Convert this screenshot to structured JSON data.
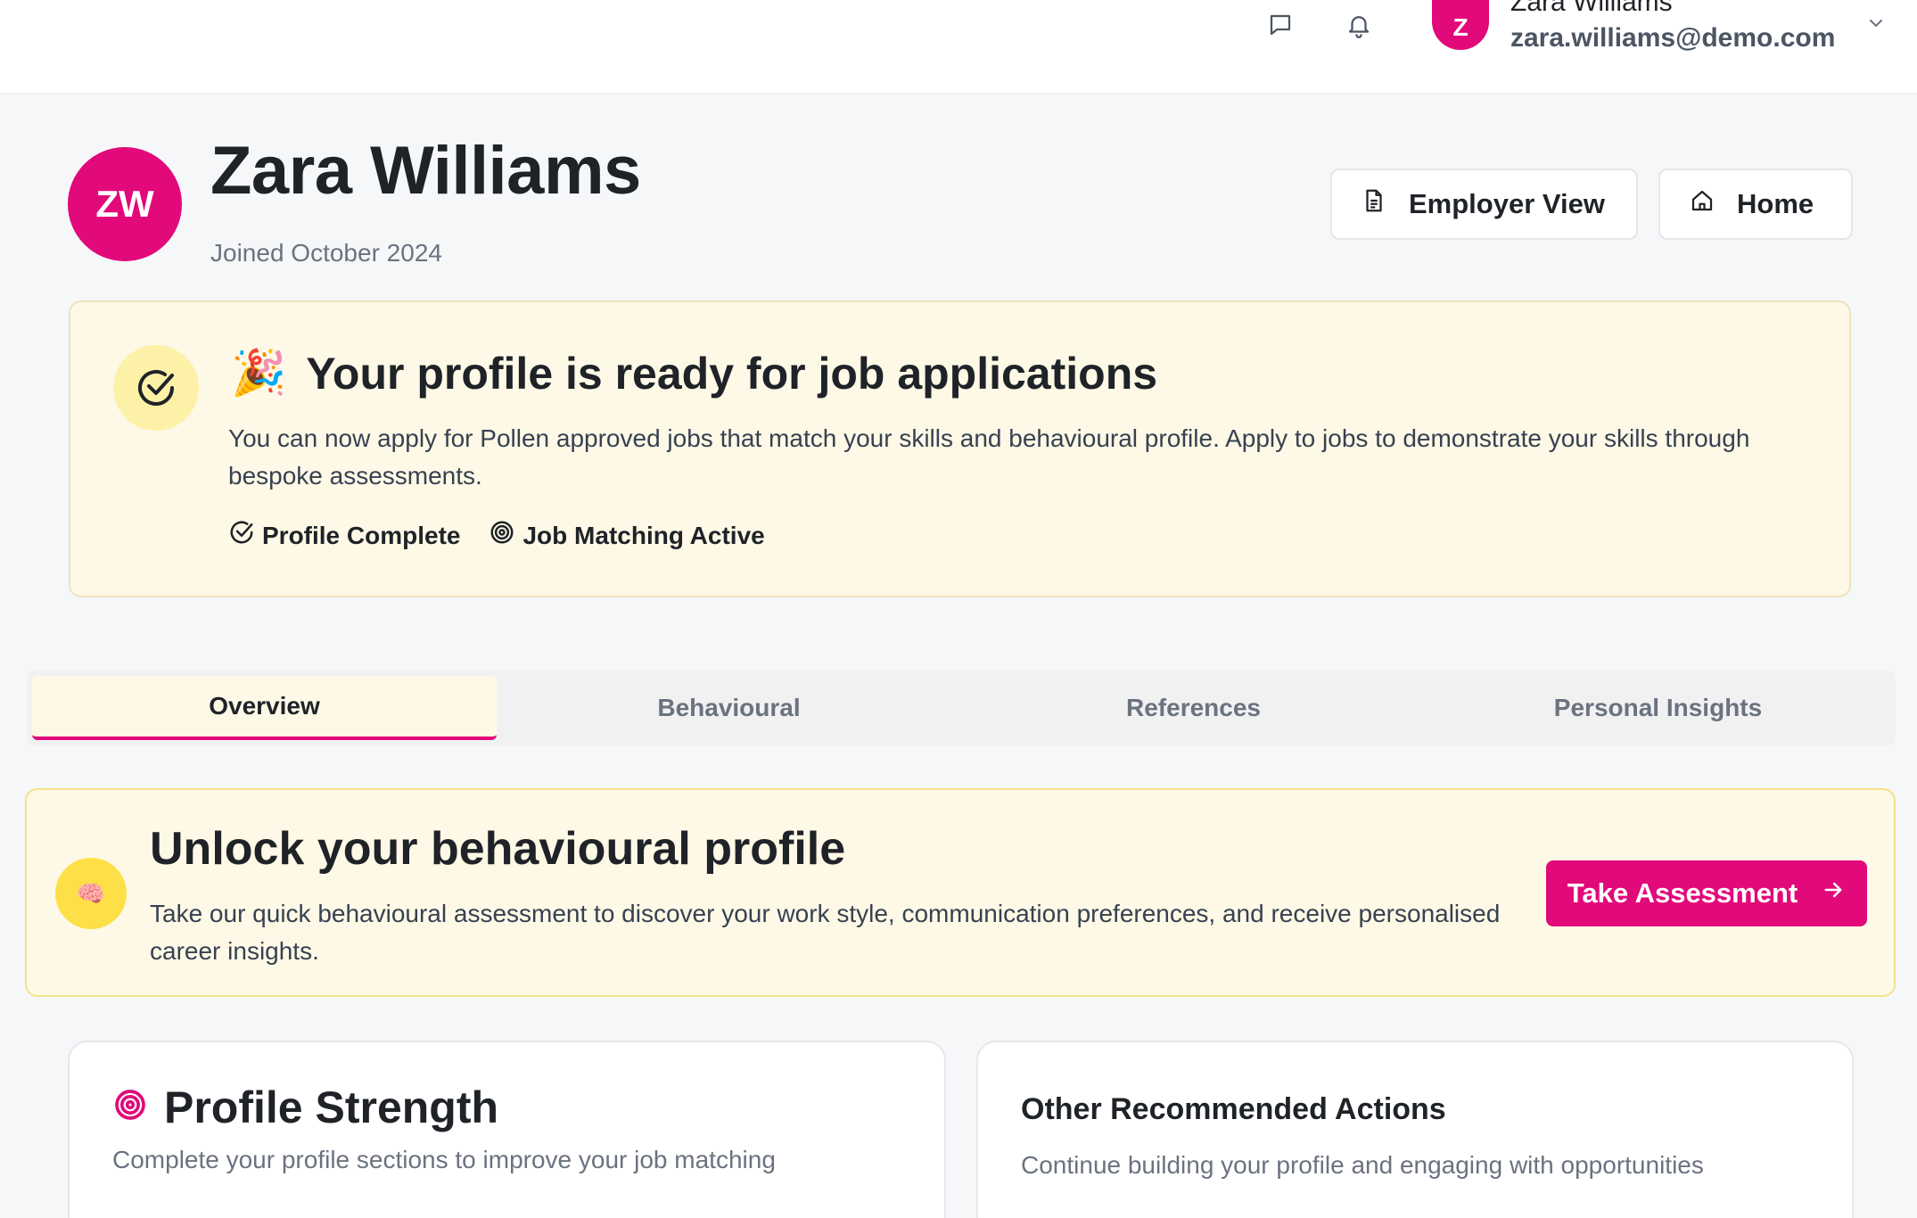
{
  "topbar": {
    "user_initial": "Z",
    "user_name": "Zara Williams",
    "user_email": "zara.williams@demo.com",
    "icons": [
      "message-icon",
      "bell-icon",
      "chevron-down-icon"
    ]
  },
  "profile": {
    "initials": "ZW",
    "name": "Zara Williams",
    "joined": "Joined October 2024",
    "employer_view_label": "Employer View",
    "home_label": "Home"
  },
  "ready": {
    "emoji": "🎉",
    "title": "Your profile is ready for job applications",
    "description": "You can now apply for Pollen approved jobs that match your skills and behavioural profile. Apply to jobs to demonstrate your skills through bespoke assessments.",
    "badges": [
      "Profile Complete",
      "Job Matching Active"
    ]
  },
  "tabs": [
    {
      "label": "Overview",
      "active": true
    },
    {
      "label": "Behavioural",
      "active": false
    },
    {
      "label": "References",
      "active": false
    },
    {
      "label": "Personal Insights",
      "active": false
    }
  ],
  "unlock": {
    "emoji": "🧠",
    "title": "Unlock your behavioural profile",
    "description": "Take our quick behavioural assessment to discover your work style, communication preferences, and receive personalised career insights.",
    "button_label": "Take Assessment"
  },
  "strength": {
    "title": "Profile Strength",
    "subtitle": "Complete your profile sections to improve your job matching"
  },
  "actions": {
    "title": "Other Recommended Actions",
    "subtitle": "Continue building your profile and engaging with opportunities"
  },
  "colors": {
    "accent": "#e2097a",
    "card_bg": "#fef9e6",
    "icon_bg": "#fde047"
  }
}
